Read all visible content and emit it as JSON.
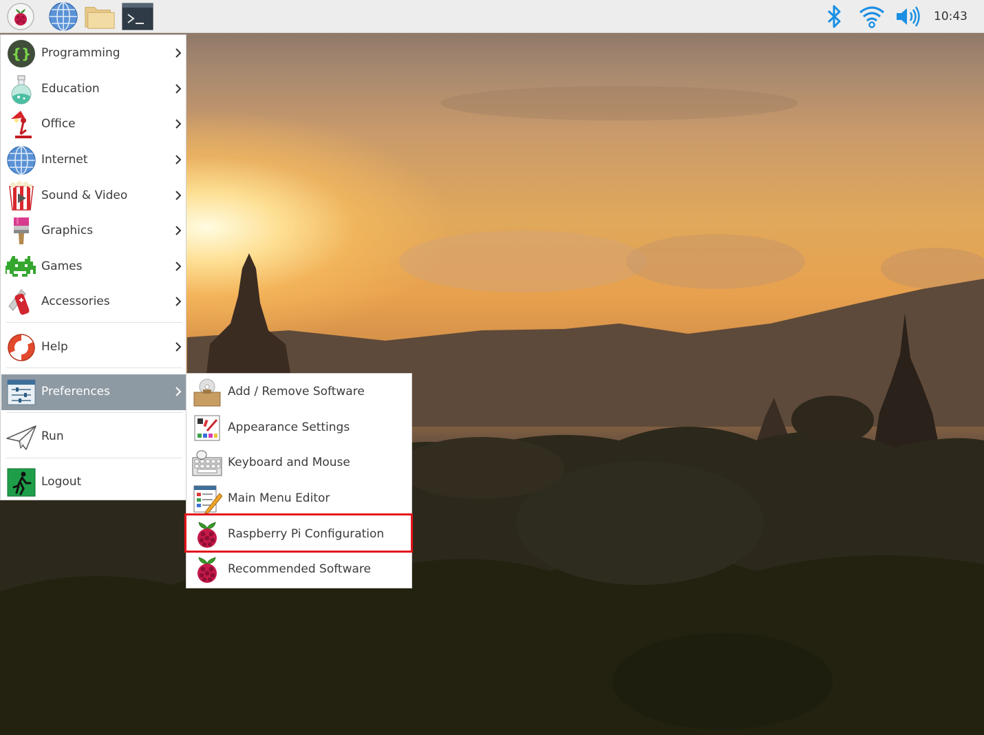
{
  "panel": {
    "launchers": [
      {
        "name": "raspberry-menu-button",
        "icon": "raspberry-icon"
      },
      {
        "name": "web-browser-launcher",
        "icon": "globe-icon"
      },
      {
        "name": "file-manager-launcher",
        "icon": "folder-icon"
      },
      {
        "name": "terminal-launcher",
        "icon": "terminal-icon"
      }
    ],
    "tray": {
      "bluetooth_icon": "bluetooth-icon",
      "wifi_icon": "wifi-icon",
      "volume_icon": "volume-icon"
    },
    "clock": "10:43"
  },
  "main_menu": {
    "items": [
      {
        "label": "Programming",
        "icon": "programming-icon",
        "has_submenu": true
      },
      {
        "label": "Education",
        "icon": "education-icon",
        "has_submenu": true
      },
      {
        "label": "Office",
        "icon": "office-icon",
        "has_submenu": true
      },
      {
        "label": "Internet",
        "icon": "internet-icon",
        "has_submenu": true
      },
      {
        "label": "Sound & Video",
        "icon": "sound-video-icon",
        "has_submenu": true
      },
      {
        "label": "Graphics",
        "icon": "graphics-icon",
        "has_submenu": true
      },
      {
        "label": "Games",
        "icon": "games-icon",
        "has_submenu": true
      },
      {
        "label": "Accessories",
        "icon": "accessories-icon",
        "has_submenu": true
      },
      {
        "label": "Help",
        "icon": "help-icon",
        "has_submenu": true
      },
      {
        "label": "Preferences",
        "icon": "preferences-icon",
        "has_submenu": true,
        "active": true
      },
      {
        "label": "Run",
        "icon": "run-icon",
        "has_submenu": false
      },
      {
        "label": "Logout",
        "icon": "logout-icon",
        "has_submenu": false
      }
    ]
  },
  "preferences_submenu": {
    "items": [
      {
        "label": "Add / Remove Software",
        "icon": "package-icon"
      },
      {
        "label": "Appearance Settings",
        "icon": "appearance-icon"
      },
      {
        "label": "Keyboard and Mouse",
        "icon": "keyboard-mouse-icon"
      },
      {
        "label": "Main Menu Editor",
        "icon": "menu-editor-icon"
      },
      {
        "label": "Raspberry Pi Configuration",
        "icon": "raspberry-icon",
        "highlighted": true
      },
      {
        "label": "Recommended Software",
        "icon": "raspberry-icon"
      }
    ]
  },
  "colors": {
    "panel_bg": "#ededed",
    "menu_active_bg": "#8e9aa3",
    "highlight_border": "#e3141c",
    "bluetooth_blue": "#1a8fe3"
  }
}
